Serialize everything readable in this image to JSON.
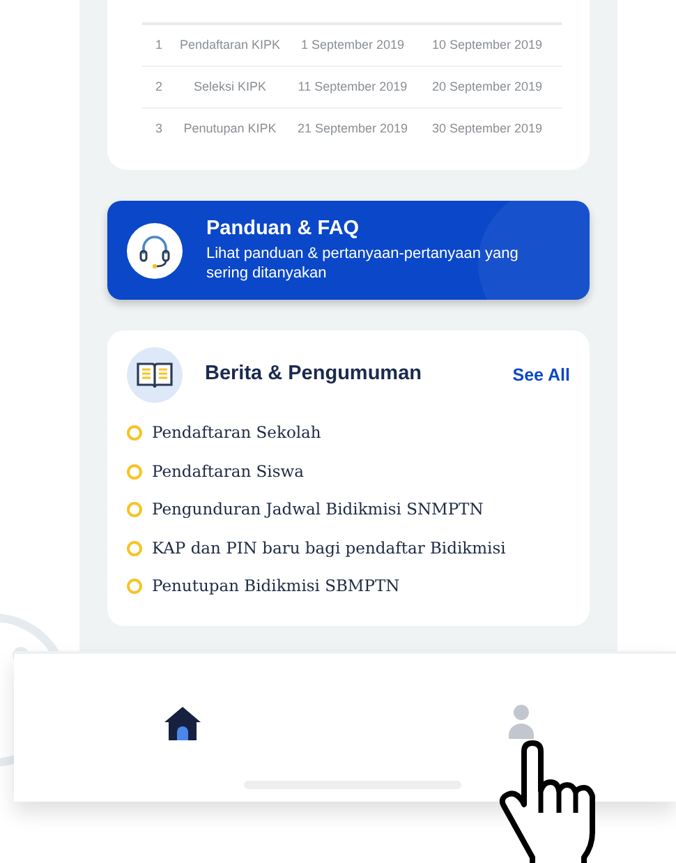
{
  "schedule_table": {
    "rows": [
      {
        "no": "1",
        "activity": "Pendaftaran KIPK",
        "opened": "1 September 2019",
        "closed": "10 September 2019"
      },
      {
        "no": "2",
        "activity": "Seleksi KIPK",
        "opened": "11 September 2019",
        "closed": "20 September 2019"
      },
      {
        "no": "3",
        "activity": "Penutupan KIPK",
        "opened": "21 September 2019",
        "closed": "30 September 2019"
      }
    ]
  },
  "guide_banner": {
    "title": "Panduan & FAQ",
    "subtitle": "Lihat panduan & pertanyaan-pertanyaan yang sering ditanyakan"
  },
  "news": {
    "title": "Berita & Pengumuman",
    "see_all": "See All",
    "items": [
      "Pendaftaran Sekolah",
      "Pendaftaran Siswa",
      "Pengunduran Jadwal Bidikmisi SNMPTN",
      "KAP dan PIN baru bagi pendaftar Bidikmisi",
      "Penutupan Bidikmisi SBMPTN"
    ]
  },
  "bottom_nav": [
    {
      "kind": "home",
      "selected": true
    },
    {
      "kind": "profile",
      "selected": false
    }
  ]
}
